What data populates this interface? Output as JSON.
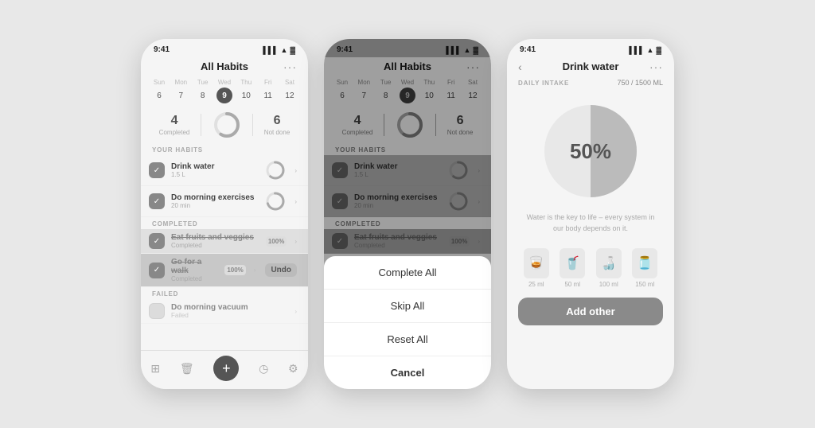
{
  "phone1": {
    "status_time": "9:41",
    "header_title": "All Habits",
    "calendar": {
      "days": [
        "Sun",
        "Mon",
        "Tue",
        "Wed",
        "Thu",
        "Fri",
        "Sat"
      ],
      "dates": [
        "6",
        "7",
        "8",
        "9",
        "10",
        "11",
        "12"
      ],
      "active_index": 3
    },
    "stats": {
      "completed_num": "4",
      "completed_label": "Completed",
      "not_done_num": "6",
      "not_done_label": "Not done"
    },
    "your_habits_label": "YOUR HABITS",
    "habits": [
      {
        "name": "Drink water",
        "sub": "1.5 L",
        "checked": true
      },
      {
        "name": "Do morning exercises",
        "sub": "20 min",
        "checked": true
      }
    ],
    "completed_label": "COMPLETED",
    "completed_habits": [
      {
        "name": "Eat fruits and veggies",
        "sub": "Completed",
        "strikethrough": true,
        "pct": "100%"
      },
      {
        "name": "Go for a walk",
        "sub": "Completed",
        "strikethrough": true,
        "pct": "100%",
        "undo": true
      }
    ],
    "failed_label": "FAILED",
    "failed_habits": [
      {
        "name": "Do morning vacuum",
        "sub": "Failed"
      }
    ],
    "tabs": [
      "grid",
      "trash",
      "add",
      "clock",
      "gear"
    ]
  },
  "phone2": {
    "status_time": "9:41",
    "header_title": "All Habits",
    "calendar": {
      "days": [
        "Sun",
        "Mon",
        "Tue",
        "Wed",
        "Thu",
        "Fri",
        "Sat"
      ],
      "dates": [
        "6",
        "7",
        "8",
        "9",
        "10",
        "11",
        "12"
      ],
      "active_index": 3
    },
    "stats": {
      "completed_num": "4",
      "completed_label": "Completed",
      "not_done_num": "6",
      "not_done_label": "Not done"
    },
    "your_habits_label": "YOUR HABITS",
    "habits": [
      {
        "name": "Drink water",
        "sub": "1.5 L"
      },
      {
        "name": "Do morning exercises",
        "sub": "20 min"
      }
    ],
    "completed_label": "COMPLETED",
    "completed_habits": [
      {
        "name": "Eat fruits and veggies",
        "sub": "Completed",
        "strikethrough": true,
        "pct": "100%"
      }
    ],
    "action_sheet": {
      "items": [
        "Complete All",
        "Skip All",
        "Reset All"
      ],
      "cancel": "Cancel"
    }
  },
  "phone3": {
    "status_time": "9:41",
    "header_title": "Drink water",
    "daily_intake_label": "DAILY INTAKE",
    "daily_intake_value": "750 / 1500 ML",
    "percent": "50%",
    "description": "Water is the key to life – every system in our body depends on it.",
    "cups": [
      {
        "label": "25 ml",
        "icon": "🥃"
      },
      {
        "label": "50 ml",
        "icon": "🥤"
      },
      {
        "label": "100 ml",
        "icon": "🍶"
      },
      {
        "label": "150 ml",
        "icon": "🫙"
      }
    ],
    "add_other_label": "Add other"
  }
}
